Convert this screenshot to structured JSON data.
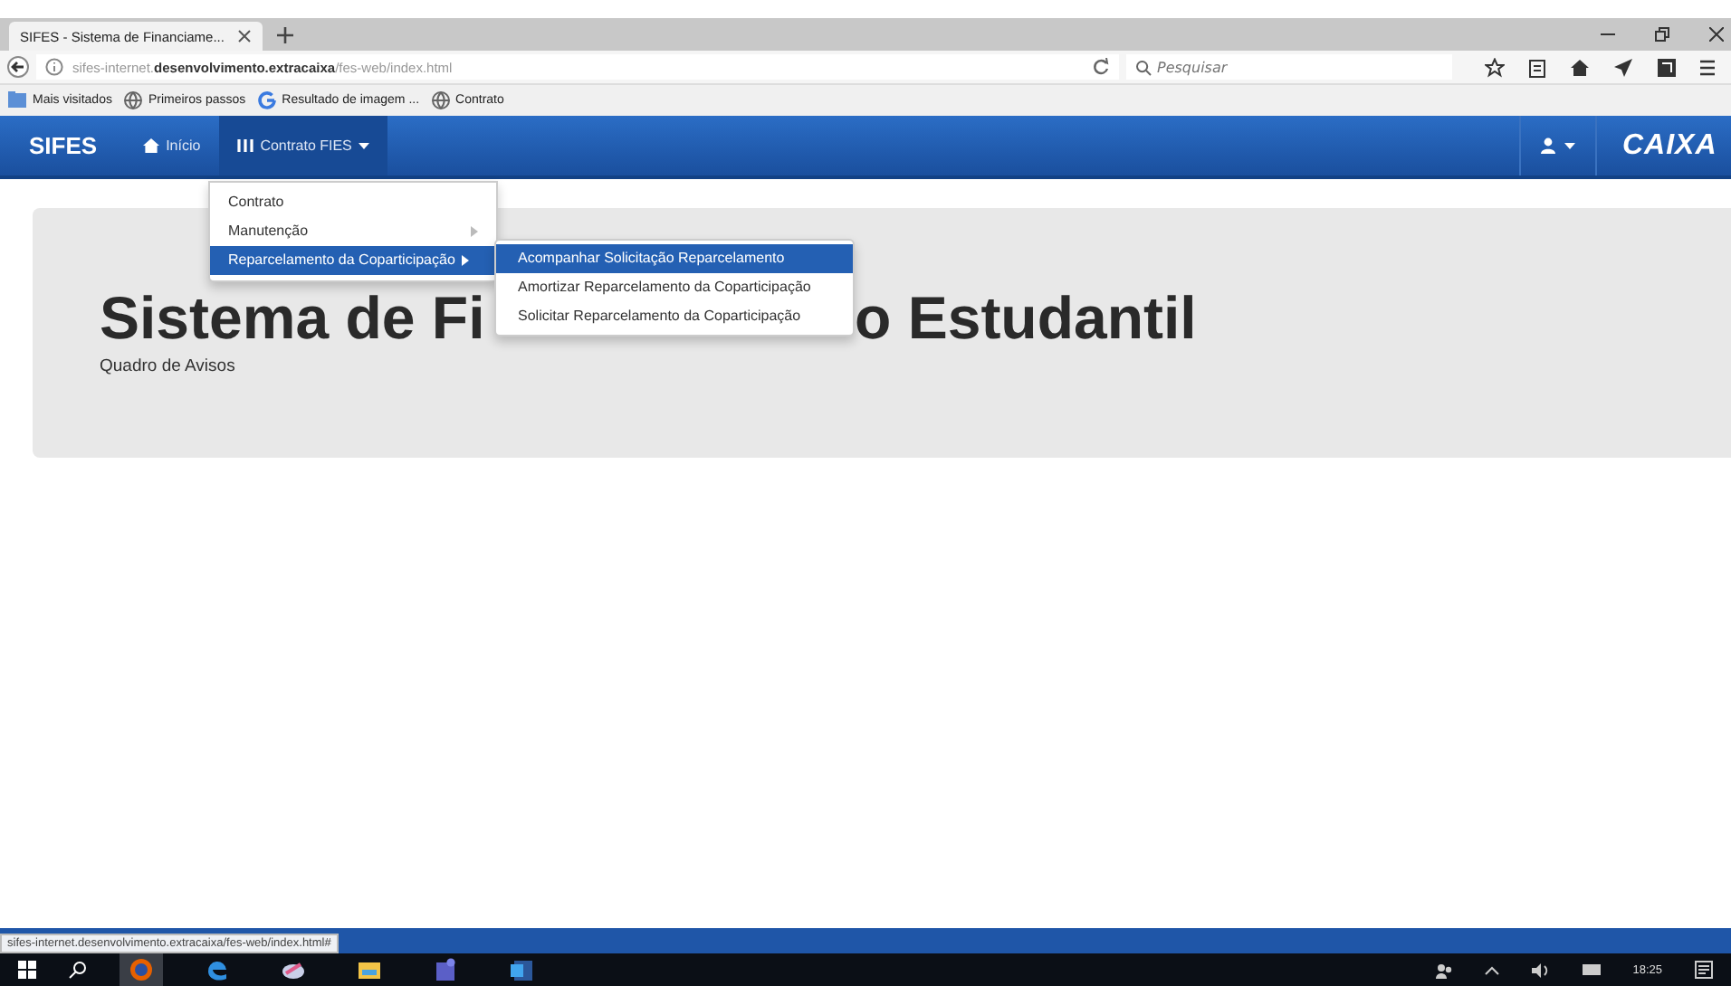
{
  "browser": {
    "tabs": [
      {
        "title": "SIFES - Sistema de Financiame...",
        "selected": true
      }
    ],
    "address": {
      "url": "sifes-internet.**desenvolvimento.extracaixa**/fes-web/index.html"
    },
    "search": {
      "placeholder": "Pesquisar"
    },
    "bookmarks": [
      {
        "label": "Mais visitados",
        "kind": "folder"
      },
      {
        "label": "Primeiros passos",
        "kind": "globe"
      },
      {
        "label": "Resultado de imagem ...",
        "kind": "google"
      },
      {
        "label": "Contrato",
        "kind": "globe"
      }
    ]
  },
  "navbar": {
    "brand": "SIFES",
    "items": [
      {
        "label": "Início",
        "kind": "home",
        "selected": false
      },
      {
        "label": "Contrato FIES",
        "kind": "grid",
        "selected": true
      }
    ],
    "logo": "CAIXA"
  },
  "menu": {
    "items": [
      {
        "label": "Contrato",
        "kind": "plain",
        "selected": false
      },
      {
        "label": "Manutenção",
        "kind": "submenu",
        "selected": false
      },
      {
        "label": "Reparcelamento da Coparticipação",
        "kind": "submenu",
        "selected": true
      }
    ],
    "submenu": [
      {
        "label": "Acompanhar Solicitação Reparcelamento",
        "selected": true
      },
      {
        "label": "Amortizar Reparcelamento da Coparticipação",
        "selected": false
      },
      {
        "label": "Solicitar Reparcelamento da Coparticipação",
        "selected": false
      }
    ]
  },
  "jumbotron": {
    "title_parts": [
      "Sistema de Fi",
      "o Estudantil"
    ],
    "subtitle": "Quadro de Avisos"
  },
  "status_bar": {
    "url": "sifes-internet.desenvolvimento.extracaixa/fes-web/index.html#"
  },
  "taskbar": {
    "time": "18:25"
  }
}
